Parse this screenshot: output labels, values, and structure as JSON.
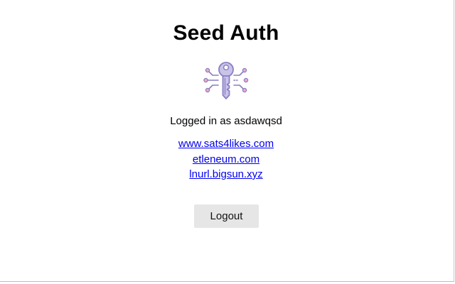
{
  "header": {
    "title": "Seed Auth",
    "logo_icon": "key-circuit-icon"
  },
  "status": {
    "text": "Logged in as asdawqsd"
  },
  "sites": [
    {
      "label": "www.sats4likes.com"
    },
    {
      "label": "etleneum.com"
    },
    {
      "label": "lnurl.bigsun.xyz"
    }
  ],
  "actions": {
    "logout_label": "Logout"
  },
  "colors": {
    "link": "#0000ee",
    "icon_stroke": "#8a7fc0",
    "icon_fill": "#c9c3ea",
    "icon_node": "#f0a8c8",
    "button_bg": "#e6e6e6"
  }
}
